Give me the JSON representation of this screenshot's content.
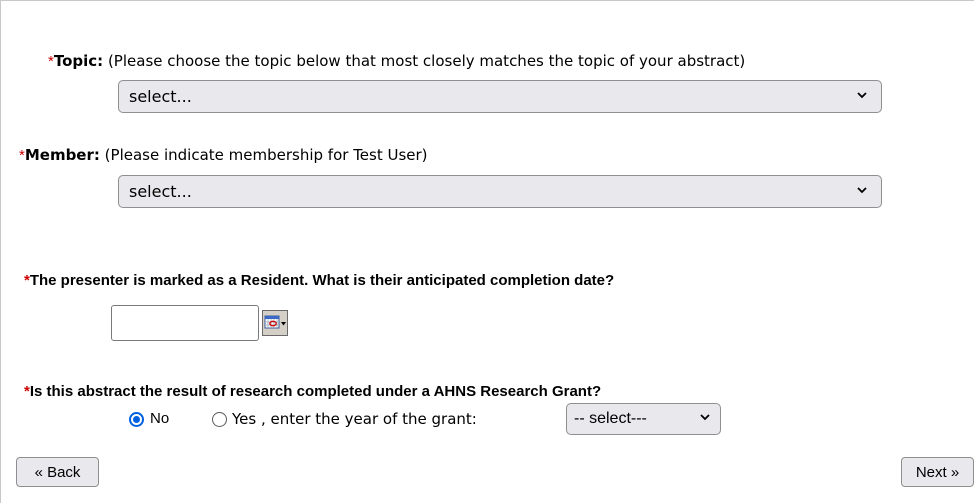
{
  "topic": {
    "required_mark": "*",
    "label": "Topic:",
    "hint": "(Please choose the topic below that most closely matches the topic of your abstract)",
    "select_value": "select..."
  },
  "member": {
    "required_mark": "*",
    "label": "Member:",
    "hint": "(Please indicate membership for Test User)",
    "select_value": "select..."
  },
  "completion": {
    "required_mark": "*",
    "question": "The presenter is marked as a Resident. What is their anticipated completion date?",
    "date_value": ""
  },
  "grant": {
    "required_mark": "*",
    "question": "Is this abstract the result of research completed under a AHNS Research Grant?",
    "option_no": "No",
    "option_yes": "Yes , enter the year of the grant:",
    "selected": "No",
    "year_select_value": "-- select---"
  },
  "nav": {
    "back_label": "« Back",
    "next_label": "Next »"
  },
  "colors": {
    "required": "#cc0000",
    "radio_selected": "#0060df",
    "select_bg": "#e9e9ed"
  }
}
